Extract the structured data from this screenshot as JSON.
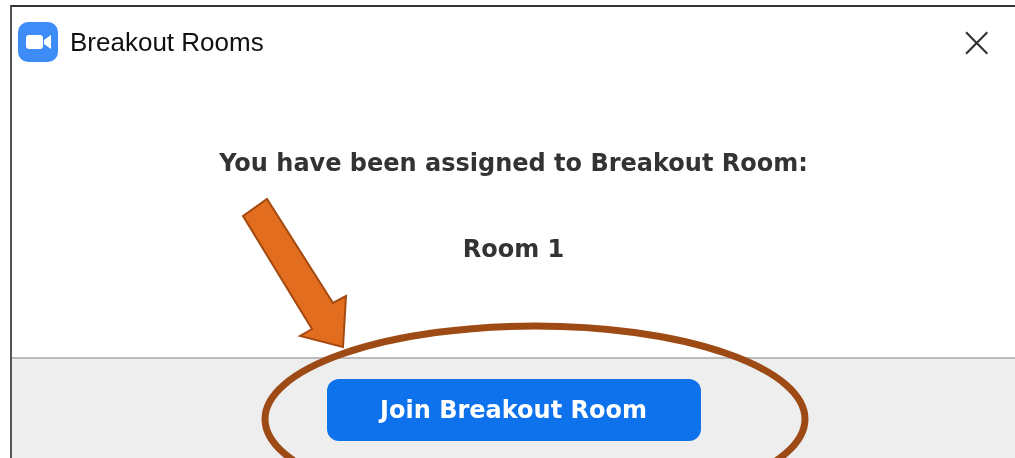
{
  "window": {
    "title": "Breakout Rooms",
    "close": "×"
  },
  "message": "You have been assigned to Breakout Room:",
  "room": "Room 1",
  "buttons": [
    {
      "label": "Join Breakout Room"
    }
  ],
  "annotations": [
    {
      "kind": "arrow",
      "color": "#e26d1f"
    },
    {
      "kind": "ellipse",
      "color": "#9e4a14"
    }
  ]
}
